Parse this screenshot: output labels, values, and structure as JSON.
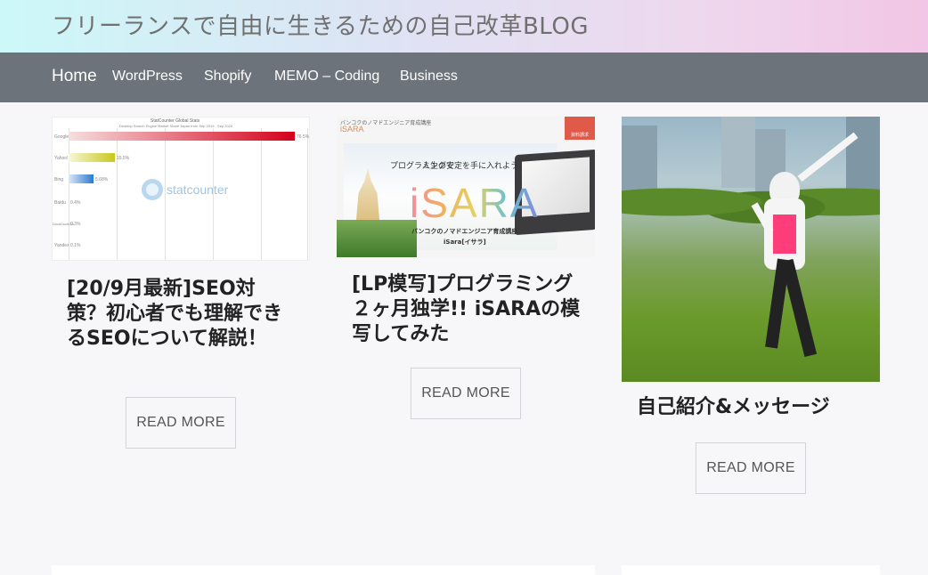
{
  "header": {
    "site_title": "フリーランスで自由に生きるための自己改革BLOG"
  },
  "nav": {
    "items": [
      {
        "label": "Home"
      },
      {
        "label": "WordPress"
      },
      {
        "label": "Shopify"
      },
      {
        "label": "MEMO – Coding"
      },
      {
        "label": "Business"
      }
    ]
  },
  "posts": [
    {
      "title": "[20/9月最新]SEO対策？初心者でも理解できるSEOについて解説！",
      "read_more": "READ MORE",
      "thumb": {
        "chart_title": "StatCounter Global Stats",
        "chart_subtitle": "Desktop Search Engine Market Share Japan from Sep 2019 - Sep 2020",
        "logo_text": "statcounter",
        "rows": [
          {
            "label": "Google",
            "value": "76.5%"
          },
          {
            "label": "Yahoo!",
            "value": "15.5%"
          },
          {
            "label": "Bing",
            "value": "5.68%"
          },
          {
            "label": "Baidu",
            "value": "0.4%"
          },
          {
            "label": "DuckDuckGo",
            "value": "0.3%"
          },
          {
            "label": "Yandex",
            "value": "0.1%"
          }
        ]
      }
    },
    {
      "title": "[LP模写]プログラミング２ヶ月独学!! iSARAの模写してみた",
      "read_more": "READ MORE",
      "thumb": {
        "top_caption": "バンコクのノマドエンジニア育成講座",
        "small_logo": "iSARA",
        "badge": "資料請求",
        "tagline_1": "プログラミングで",
        "tagline_2": "人生の安定を手に入れよう",
        "big_logo": "iSARA",
        "footer_1": "バンコクのノマドエンジニア育成講座",
        "footer_2": "iSara[イサラ]"
      }
    },
    {
      "title": "自己紹介&メッセージ",
      "read_more": "READ MORE"
    }
  ],
  "colors": {
    "nav_bg": "#6c737b",
    "header_gradient_start": "#ccf8f8",
    "header_gradient_end": "#f2c6e6",
    "page_bg": "#f7f7f9"
  }
}
